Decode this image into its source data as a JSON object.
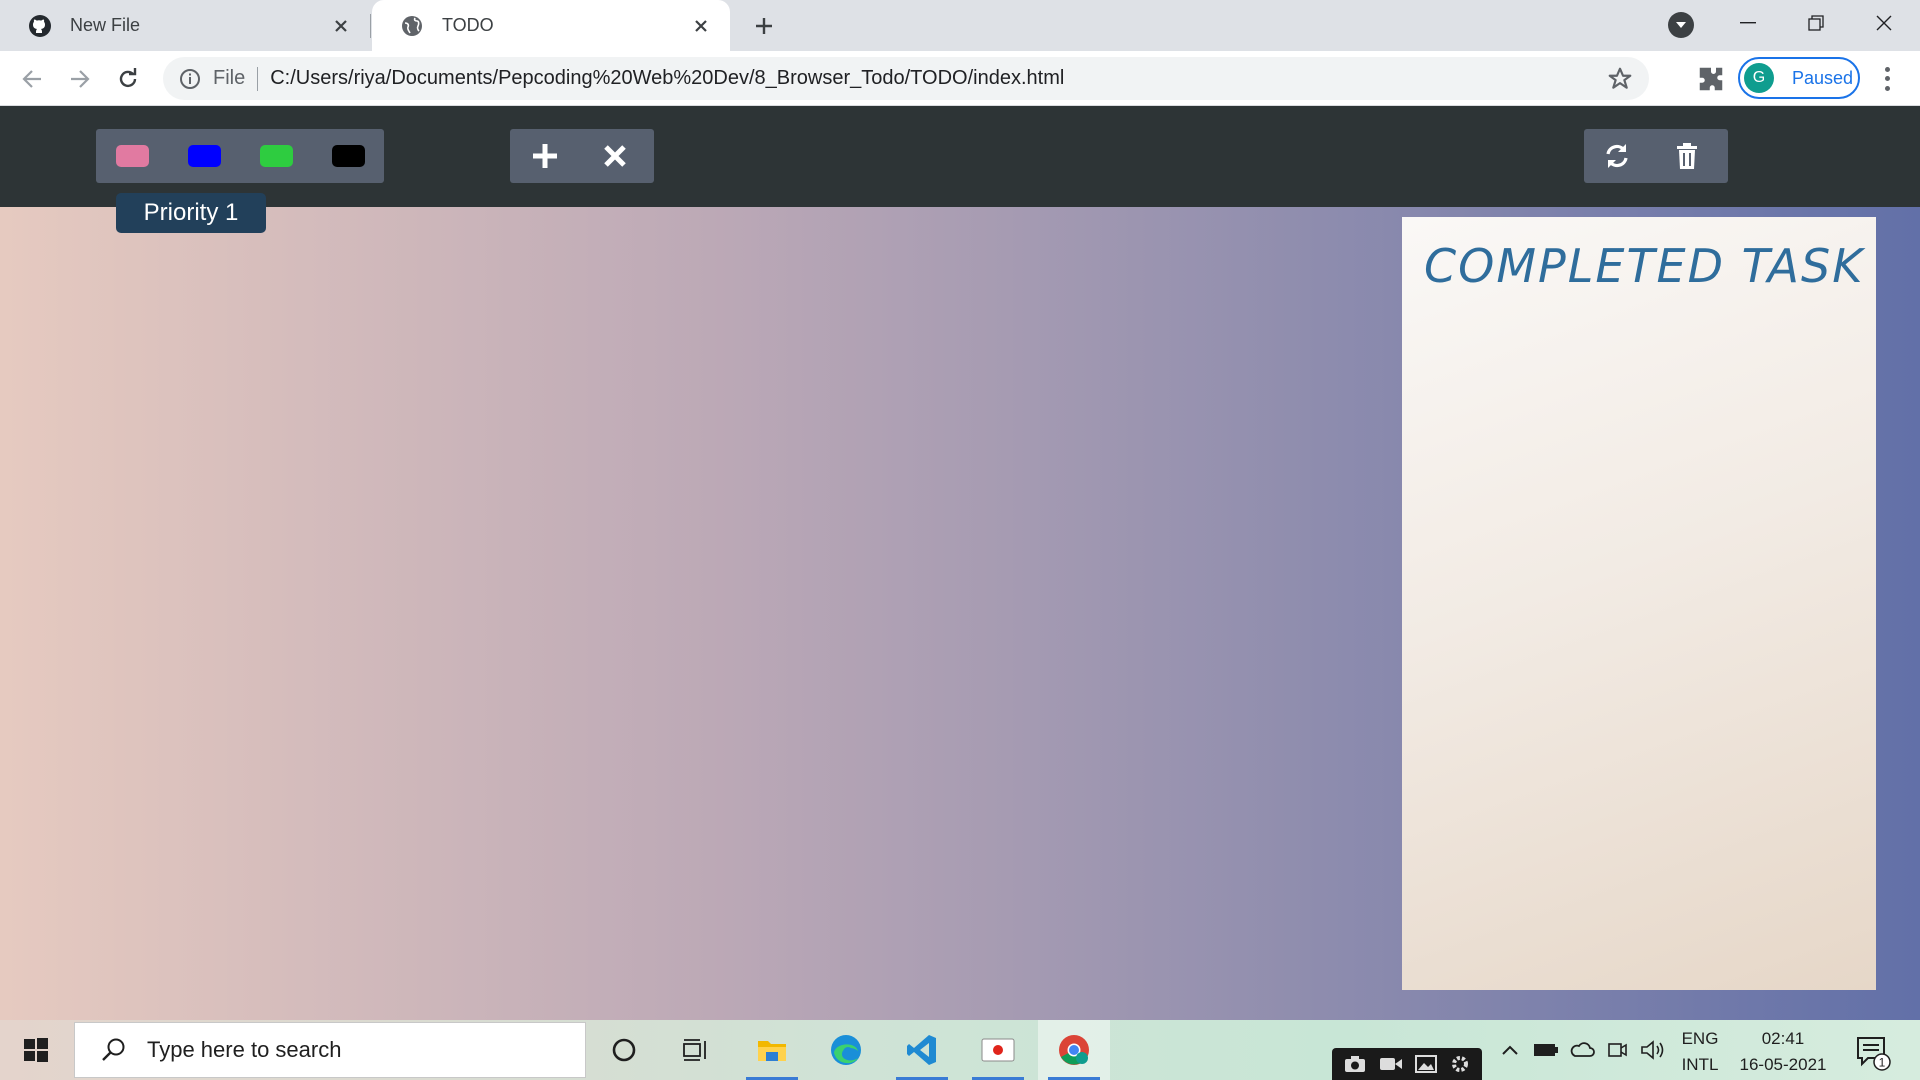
{
  "browser": {
    "tabs": [
      {
        "title": "New File",
        "favicon": "github-icon",
        "active": false
      },
      {
        "title": "TODO",
        "favicon": "globe-icon",
        "active": true
      }
    ],
    "address": {
      "scheme_label": "File",
      "url": "C:/Users/riya/Documents/Pepcoding%20Web%20Dev/8_Browser_Todo/TODO/index.html"
    },
    "profile": {
      "initial": "G",
      "status": "Paused"
    }
  },
  "app": {
    "filter_colors": [
      {
        "name": "pink",
        "color": "#e17aa1"
      },
      {
        "name": "blue",
        "color": "#0000ff"
      },
      {
        "name": "green",
        "color": "#2ecc40"
      },
      {
        "name": "black",
        "color": "#000000"
      }
    ],
    "tooltip": "Priority 1",
    "actions": [
      "plus-icon",
      "close-icon"
    ],
    "tools": [
      "refresh-icon",
      "trash-icon"
    ],
    "completed_title": "COMPLETED TASK",
    "colors": {
      "appbar": "#2d3436",
      "panel": "#57606f",
      "title": "#2f6d9c"
    }
  },
  "taskbar": {
    "search_placeholder": "Type here to search",
    "language": {
      "line1": "ENG",
      "line2": "INTL"
    },
    "clock": {
      "time": "02:41",
      "date": "16-05-2021"
    },
    "notification_count": "1"
  }
}
